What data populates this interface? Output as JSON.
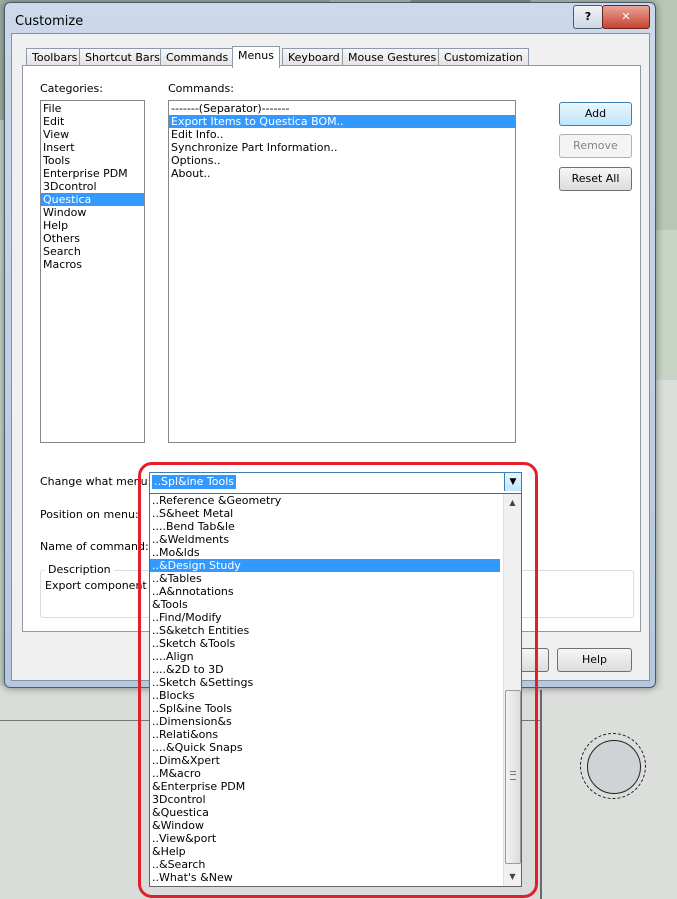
{
  "window": {
    "title": "Customize",
    "help_glyph": "?",
    "close_glyph": "✕"
  },
  "tabs": [
    "Toolbars",
    "Shortcut Bars",
    "Commands",
    "Menus",
    "Keyboard",
    "Mouse Gestures",
    "Customization"
  ],
  "active_tab": "Menus",
  "categories": {
    "label": "Categories:",
    "items": [
      "File",
      "Edit",
      "View",
      "Insert",
      "Tools",
      "Enterprise PDM",
      "3Dcontrol",
      "Questica",
      "Window",
      "Help",
      "Others",
      "Search",
      "Macros"
    ],
    "selected": "Questica"
  },
  "commands": {
    "label": "Commands:",
    "items": [
      "-------(Separator)-------",
      "Export Items to Questica BOM..",
      "Edit Info..",
      "Synchronize Part Information..",
      "Options..",
      "About.."
    ],
    "selected": "Export Items to Questica BOM.."
  },
  "buttons": {
    "add": "Add",
    "remove": "Remove",
    "reset_all": "Reset All",
    "help": "Help"
  },
  "form": {
    "change_menu_label": "Change what menu:",
    "position_label": "Position on menu:",
    "name_label": "Name of command:",
    "description_legend": "Description",
    "description_text": "Export component in"
  },
  "menu_combo": {
    "value": "..Spl&ine Tools",
    "arrow_glyph": "▼",
    "options": [
      "..Reference &Geometry",
      "..S&heet Metal",
      "....Bend Tab&le",
      "..&Weldments",
      "..Mo&lds",
      "..&Design Study",
      "..&Tables",
      "..A&nnotations",
      "&Tools",
      "..Find/Modify",
      "..S&ketch Entities",
      "..Sketch &Tools",
      "....Align",
      "....&2D to 3D",
      "..Sketch &Settings",
      "..Blocks",
      "..Spl&ine Tools",
      "..Dimension&s",
      "..Relati&ons",
      "....&Quick Snaps",
      "..Dim&Xpert",
      "..M&acro",
      "&Enterprise PDM",
      "3Dcontrol",
      "&Questica",
      "&Window",
      "..View&port",
      "&Help",
      "..&Search",
      "..What's &New"
    ],
    "highlighted": "..&Design Study",
    "scroll_up": "▲",
    "scroll_down": "▼"
  }
}
